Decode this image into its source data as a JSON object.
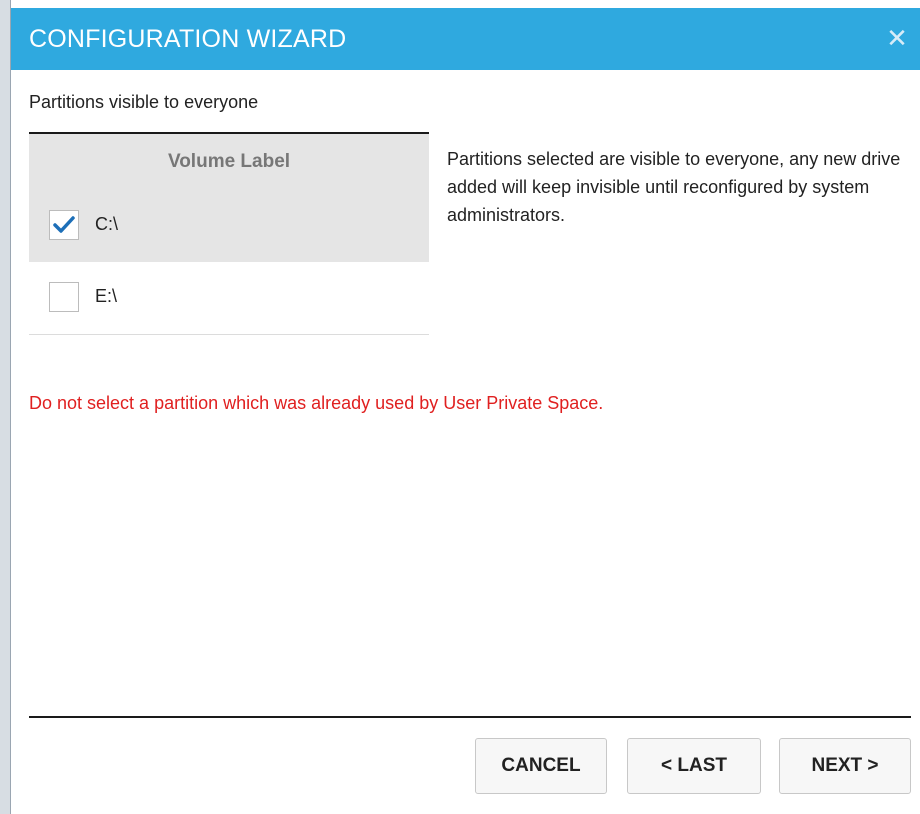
{
  "window": {
    "title": "CONFIGURATION WIZARD",
    "close_icon": "close-icon",
    "title_bar_color": "#2fa9df"
  },
  "section_label": "Partitions visible to everyone",
  "table": {
    "header": "Volume Label",
    "rows": [
      {
        "label": "C:\\",
        "checked": true,
        "selected": true
      },
      {
        "label": "E:\\",
        "checked": false,
        "selected": false
      }
    ]
  },
  "description": "Partitions selected are visible to everyone, any new drive added will keep invisible until reconfigured by system administrators.",
  "warning": {
    "text": "Do not select a partition which was already used by User Private Space.",
    "color": "#e02020"
  },
  "buttons": {
    "cancel": "CANCEL",
    "last": "< LAST",
    "next": "NEXT >"
  },
  "colors": {
    "checkmark": "#1d6fb8"
  }
}
